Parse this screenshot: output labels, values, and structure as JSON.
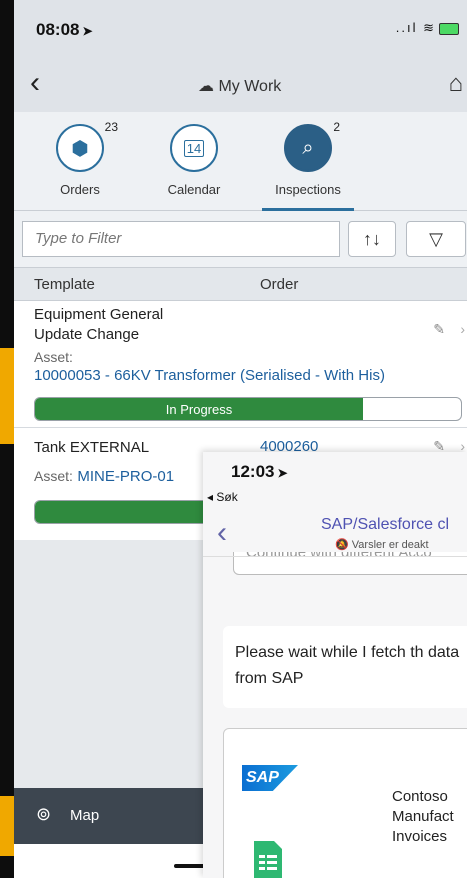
{
  "phone1": {
    "status": {
      "time": "08:08",
      "location_glyph": "➤"
    },
    "navbar": {
      "title": "My Work"
    },
    "tabs": [
      {
        "label": "Orders",
        "badge": "23",
        "icon": "cube-icon"
      },
      {
        "label": "Calendar",
        "badge": "",
        "icon": "calendar-icon",
        "day": "14"
      },
      {
        "label": "Inspections",
        "badge": "2",
        "icon": "inspection-icon"
      }
    ],
    "filter": {
      "placeholder": "Type to Filter"
    },
    "table": {
      "headers": {
        "template": "Template",
        "order": "Order"
      },
      "rows": [
        {
          "template_line1": "Equipment General",
          "template_line2": "Update Change",
          "asset_label": "Asset:",
          "asset_value": "10000053 - 66KV Transformer (Serialised - With His)",
          "status": "In Progress",
          "progress": 0.77
        },
        {
          "template_line1": "Tank EXTERNAL",
          "order": "4000260",
          "asset_label": "Asset:",
          "asset_value": "MINE-PRO-01",
          "progress": 0.6
        }
      ]
    },
    "bottom": {
      "map_label": "Map"
    }
  },
  "phone2": {
    "time": "12:03",
    "back_label": "◂ Søk",
    "chat_title": "SAP/Salesforce cl",
    "muted_text": "Varsler er deakt",
    "prev_card_text": "Continue with different Acco",
    "message": "Please wait while I fetch th data from SAP",
    "card": {
      "sap_logo_text": "SAP",
      "text_lines": [
        "Contoso",
        "Manufact",
        "Invoices"
      ]
    }
  },
  "colors": {
    "accent_blue": "#2b6f9d",
    "progress_green": "#2f8a3e",
    "teams_purple": "#6264a7",
    "side_strip": "#f0a800"
  }
}
